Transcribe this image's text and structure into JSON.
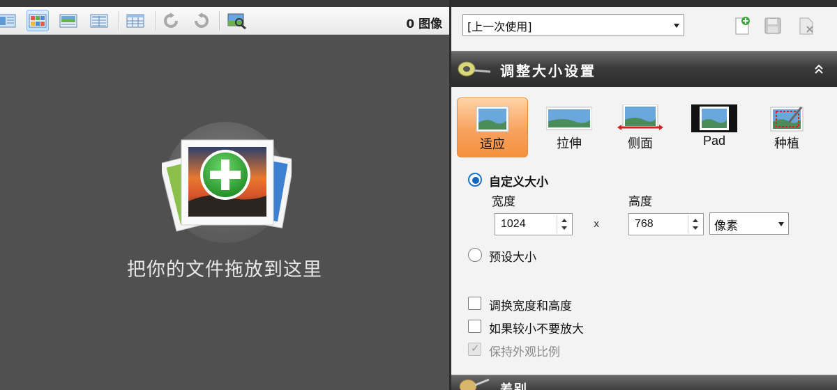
{
  "toolbar": {
    "buttons": [
      {
        "name": "view-list-icon"
      },
      {
        "name": "view-grid-icon"
      },
      {
        "name": "view-thumbnail-icon"
      },
      {
        "name": "view-details-icon"
      },
      {
        "name": "view-table-icon"
      },
      {
        "name": "rotate-left-icon"
      },
      {
        "name": "rotate-right-icon"
      },
      {
        "name": "preview-icon"
      }
    ],
    "image_count": "0 图像"
  },
  "drop_area": {
    "text": "把你的文件拖放到这里",
    "icon": "add-images-icon"
  },
  "preset": {
    "selected": "[上一次使用]",
    "icons": [
      "new-preset-icon",
      "save-preset-icon",
      "delete-preset-icon"
    ]
  },
  "resize_section": {
    "title": "调整大小设置",
    "modes": [
      {
        "label": "适应",
        "active": true
      },
      {
        "label": "拉伸",
        "active": false
      },
      {
        "label": "侧面",
        "active": false
      },
      {
        "label": "Pad",
        "active": false
      },
      {
        "label": "种植",
        "active": false
      }
    ],
    "custom_size_label": "自定义大小",
    "width_label": "宽度",
    "height_label": "高度",
    "width_value": "1024",
    "height_value": "768",
    "times": "x",
    "unit": "像素",
    "preset_size_label": "预设大小",
    "swap_label": "调换宽度和高度",
    "no_enlarge_label": "如果较小不要放大",
    "keep_aspect_label": "保持外观比例"
  },
  "bottom_section": {
    "title": "差别"
  },
  "colors": {
    "accent_orange": "#f4913f",
    "dark_pane": "#505050",
    "header_dark": "#2c2c2c",
    "radio_blue": "#1565c0"
  }
}
